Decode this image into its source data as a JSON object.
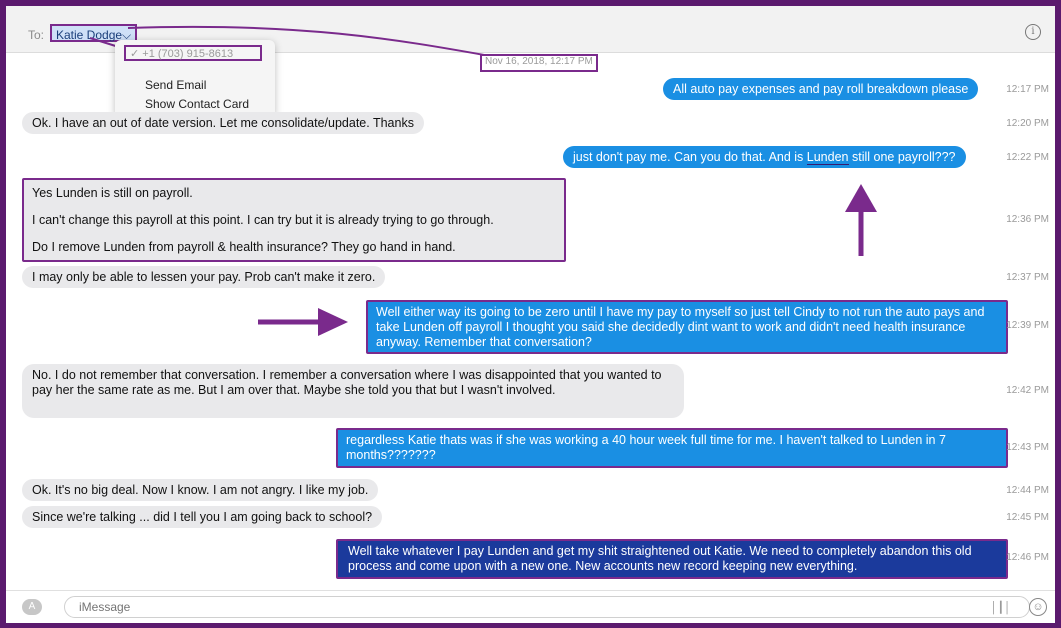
{
  "header": {
    "to_label": "To:",
    "recipient": "Katie Dodge",
    "recipient_chevron": "chevron-down-icon",
    "info_icon": "info-icon"
  },
  "dropdown": {
    "phone": "✓ +1 (703) 915-8613",
    "send_email": "Send Email",
    "show_contact": "Show Contact Card"
  },
  "top_timestamp": "Nov 16, 2018, 12:17 PM",
  "messages": [
    {
      "dir": "sent",
      "text": "All auto pay expenses and pay roll breakdown please",
      "time": "12:17 PM"
    },
    {
      "dir": "recv",
      "text": "Ok. I have an out of date version. Let me consolidate/update. Thanks",
      "time": "12:20 PM"
    },
    {
      "dir": "sent",
      "text_a": "just don't pay me. Can you do that. And is ",
      "text_b": "Lunden",
      "text_c": " still one payroll???",
      "time": "12:22 PM"
    },
    {
      "dir": "recv",
      "lines": [
        "Yes Lunden is still on payroll.",
        "I can't change this payroll at this point. I can try but it is already trying to go through.",
        "Do I remove Lunden from payroll & health insurance? They go hand in hand."
      ],
      "time": "12:36 PM"
    },
    {
      "dir": "recv",
      "text": "I may only be able to lessen your pay. Prob can't make it zero.",
      "time": "12:37 PM"
    },
    {
      "dir": "sent",
      "text": "Well either way its going to be zero until I have my pay to myself so just tell Cindy to not run the auto pays and take Lunden off payroll I thought you said she decidedly dint want to work and didn't need health insurance anyway. Remember that conversation?",
      "time": "12:39 PM"
    },
    {
      "dir": "recv",
      "text": "No. I do not remember that conversation.  I remember a conversation where I was disappointed that you wanted to pay her the same rate as me. But I am over that.  Maybe she told you that but I wasn't involved.",
      "time": "12:42 PM"
    },
    {
      "dir": "sent",
      "text": "regardless Katie thats was if she was working a 40 hour week full time for me. I haven't talked to Lunden in 7 months???????",
      "time": "12:43 PM"
    },
    {
      "dir": "recv",
      "text": "Ok. It's no big deal. Now I know.  I am not angry. I like my job.",
      "time": "12:44 PM"
    },
    {
      "dir": "recv",
      "text": "Since we're talking ... did I tell you I am going back to school?",
      "time": "12:45 PM"
    },
    {
      "dir": "sent",
      "text": "Well take whatever I pay Lunden and get my shit straightened out Katie. We need to completely abandon this old process and come upon with a new one. New accounts new record keeping new everything.",
      "time": "12:46 PM"
    }
  ],
  "footer": {
    "app_icon": "app-store-icon",
    "placeholder": "iMessage",
    "wave_icon": "audio-wave-icon",
    "emoji_icon": "emoji-icon"
  },
  "colors": {
    "annotation": "#7a2a8c",
    "sent_bubble": "#1a8fe3",
    "recv_bubble": "#e9e9eb"
  }
}
